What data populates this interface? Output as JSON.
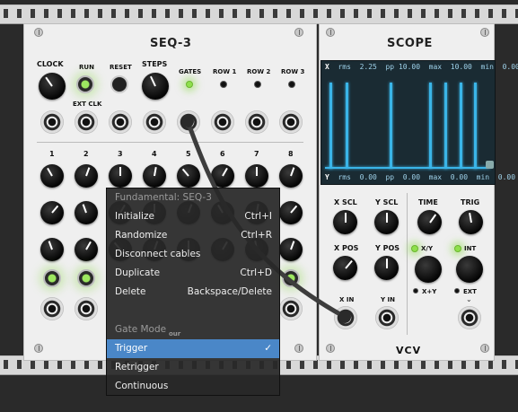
{
  "seq3": {
    "title": "SEQ-3",
    "labels": {
      "clock": "CLOCK",
      "run": "RUN",
      "ext_clk": "EXT CLK",
      "reset": "RESET",
      "steps": "STEPS",
      "gates": "GATES",
      "row1": "ROW 1",
      "row2": "ROW 2",
      "row3": "ROW 3"
    },
    "step_numbers": [
      "1",
      "2",
      "3",
      "4",
      "5",
      "6",
      "7",
      "8"
    ],
    "partial_label": "our"
  },
  "scope": {
    "title": "SCOPE",
    "top_line": {
      "ch": "X",
      "rms_l": "rms",
      "rms_v": "2.25",
      "pp_l": "pp",
      "pp_v": "10.00",
      "max_l": "max",
      "max_v": "10.00",
      "min_l": "min",
      "min_v": "0.00"
    },
    "bottom_line": {
      "ch": "Y",
      "rms_l": "rms",
      "rms_v": "0.00",
      "pp_l": "pp",
      "pp_v": "0.00",
      "max_l": "max",
      "max_v": "0.00",
      "min_l": "min",
      "min_v": "0.00"
    },
    "labels": {
      "x_scl": "X SCL",
      "y_scl": "Y SCL",
      "time": "TIME",
      "trig": "TRIG",
      "x_pos": "X POS",
      "y_pos": "Y POS",
      "xy": "X/Y",
      "xpy": "X+Y",
      "int": "INT",
      "ext": "EXT",
      "x_in": "X IN",
      "y_in": "Y IN"
    },
    "logo": "VCV",
    "trace_color": "#3ab5e8"
  },
  "context_menu": {
    "title": "Fundamental: SEQ-3",
    "items": [
      {
        "label": "Initialize",
        "shortcut": "Ctrl+I"
      },
      {
        "label": "Randomize",
        "shortcut": "Ctrl+R"
      },
      {
        "label": "Disconnect cables",
        "shortcut": ""
      },
      {
        "label": "Duplicate",
        "shortcut": "Ctrl+D"
      },
      {
        "label": "Delete",
        "shortcut": "Backspace/Delete"
      }
    ],
    "section_header": "Gate Mode",
    "gate_modes": [
      {
        "label": "Trigger",
        "selected": "✓"
      },
      {
        "label": "Retrigger"
      },
      {
        "label": "Continuous"
      }
    ],
    "selected_color": "#4a87c8"
  }
}
